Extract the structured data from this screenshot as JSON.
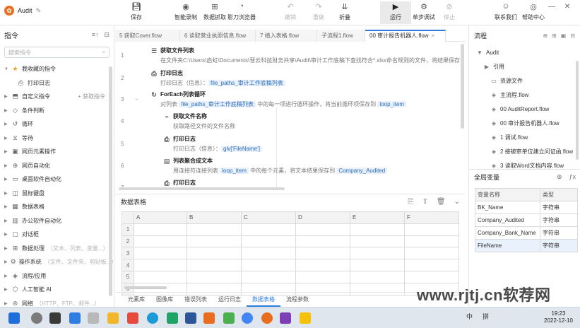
{
  "app": {
    "title": "Audit"
  },
  "toolbar": {
    "save": "保存",
    "smart_record": "智能录制",
    "data_capture": "数据抓取",
    "shadow_browser": "影刀浏览器",
    "undo": "撤销",
    "redo": "重做",
    "fold": "折叠",
    "run": "运行",
    "step_debug": "单步调试",
    "stop": "停止",
    "contact": "联系我们",
    "help": "帮助中心"
  },
  "left": {
    "title": "指令",
    "search_placeholder": "搜索指令",
    "favorites": "我收藏的指令",
    "fav_child": "打印日志",
    "custom": "自定义指令",
    "add_fav": "+ 获取指令",
    "items": [
      {
        "label": "条件判断",
        "hint": ""
      },
      {
        "label": "循环",
        "hint": ""
      },
      {
        "label": "等待",
        "hint": ""
      },
      {
        "label": "网页元素操作",
        "hint": ""
      },
      {
        "label": "网页自动化",
        "hint": ""
      },
      {
        "label": "桌面软件自动化",
        "hint": ""
      },
      {
        "label": "鼠标键盘",
        "hint": ""
      },
      {
        "label": "数据表格",
        "hint": ""
      },
      {
        "label": "办公软件自动化",
        "hint": ""
      },
      {
        "label": "对话框",
        "hint": ""
      },
      {
        "label": "数据处理",
        "hint": "（文本、列表、变量...）"
      },
      {
        "label": "操作系统",
        "hint": "（文件、文件夹、剪贴板...）"
      },
      {
        "label": "流程/应用",
        "hint": ""
      },
      {
        "label": "人工智能 AI",
        "hint": ""
      },
      {
        "label": "网络",
        "hint": "（HTTP、FTP、邮件...）"
      }
    ]
  },
  "tabs": [
    {
      "label": "5 获取Cover.flow",
      "selected": false
    },
    {
      "label": "6 读取营业执照信息.flow",
      "selected": false
    },
    {
      "label": "7 植入表格.flow",
      "selected": false
    },
    {
      "label": "子流程1.flow",
      "selected": false
    },
    {
      "label": "00 审计报告机器人.flow",
      "selected": true
    }
  ],
  "editor": {
    "lines": [
      "1",
      "2",
      "3",
      "4",
      "5",
      "6",
      "7"
    ],
    "steps": [
      {
        "title": "获取文件列表",
        "desc": "在文件夹C:\\Users\\启虹\\Documents\\彗云科技财务共享\\Audit\\审计工作底稿下查找符合*.xlsx命名规则的文件，将结果保存",
        "tag": ""
      },
      {
        "title": "打印日志",
        "desc": "打印日志（信息）：",
        "tag": "file_paths_审计工作底稿列表"
      },
      {
        "title": "ForEach列表循环",
        "desc_pre": "对列表",
        "tag1": "file_paths_审计工作底稿列表",
        "desc_mid": "中的每一项进行循环操作，将当前循环项保存到",
        "tag2": "loop_item"
      },
      {
        "title": "获取文件名称",
        "desc": "获取路径文件的文件名称",
        "tag": ""
      },
      {
        "title": "打印日志",
        "desc": "打印日志（信息）：",
        "tag": "glv['FileName']"
      },
      {
        "title": "列表聚合成文本",
        "desc_pre": "用连接符连接列表",
        "tag1": "loop_item",
        "desc_mid": "中的每个元素，将文本结果保存到",
        "tag2": "Company_Audited"
      },
      {
        "title": "打印日志",
        "desc": "",
        "tag": ""
      }
    ]
  },
  "datatable": {
    "title": "数据表格",
    "columns": [
      "A",
      "B",
      "C",
      "D",
      "E",
      "F"
    ],
    "rows": [
      "1",
      "2",
      "3",
      "4",
      "5",
      "6"
    ]
  },
  "bottom_tabs": [
    "元素库",
    "图像库",
    "错误列表",
    "运行日志",
    "数据表格",
    "流程参数"
  ],
  "right": {
    "flow_title": "流程",
    "tree": [
      {
        "label": "Audit",
        "indent": 0,
        "icon": "caret"
      },
      {
        "label": "引用",
        "indent": 1,
        "icon": "caret-right"
      },
      {
        "label": "资源文件",
        "indent": 2,
        "icon": "file"
      },
      {
        "label": "主流程.flow",
        "indent": 2,
        "icon": "flow"
      },
      {
        "label": "00 AuditReport.flow",
        "indent": 2,
        "icon": "flow"
      },
      {
        "label": "00 审计报告机器人.flow",
        "indent": 2,
        "icon": "flow"
      },
      {
        "label": "1 调试.flow",
        "indent": 2,
        "icon": "flow"
      },
      {
        "label": "2 接被审单位建立问证函.flow",
        "indent": 2,
        "icon": "flow"
      },
      {
        "label": "3 读取Word文档内容.flow",
        "indent": 2,
        "icon": "flow"
      }
    ],
    "vars_title": "全局变量",
    "vars_headers": [
      "变量名称",
      "类型"
    ],
    "vars": [
      {
        "name": "BK_Name",
        "type": "字符串",
        "selected": false
      },
      {
        "name": "Company_Audited",
        "type": "字符串",
        "selected": false
      },
      {
        "name": "Company_Bank_Name",
        "type": "字符串",
        "selected": false
      },
      {
        "name": "FileName",
        "type": "字符串",
        "selected": true
      }
    ]
  },
  "taskbar": {
    "ime": "中",
    "ime2": "拼",
    "time": "19:23",
    "date": "2022-12-10"
  },
  "watermark": "www.rjtj.cn软荐网"
}
